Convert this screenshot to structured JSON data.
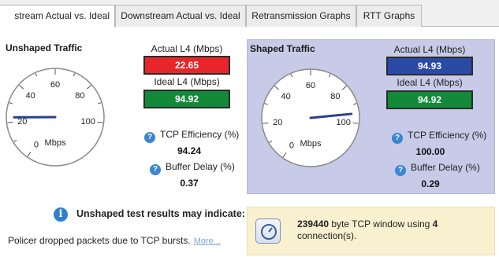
{
  "tabs": [
    {
      "label": "stream Actual vs. Ideal",
      "active": true
    },
    {
      "label": "Downstream Actual vs. Ideal",
      "active": false
    },
    {
      "label": "Retransmission Graphs",
      "active": false
    },
    {
      "label": "RTT Graphs",
      "active": false
    }
  ],
  "unshaped": {
    "title": "Unshaped Traffic",
    "gauge": {
      "unit": "Mbps",
      "ticks": [
        "0",
        "20",
        "40",
        "60",
        "80",
        "100"
      ],
      "value": 22.65,
      "max": 120
    },
    "actual_label": "Actual L4 (Mbps)",
    "actual_value": "22.65",
    "actual_color": "#e8262a",
    "ideal_label": "Ideal L4 (Mbps)",
    "ideal_value": "94.92",
    "ideal_color": "#13893a",
    "efficiency_label": "TCP Efficiency (%)",
    "efficiency_value": "94.24",
    "buffer_label": "Buffer Delay (%)",
    "buffer_value": "0.37"
  },
  "shaped": {
    "title": "Shaped Traffic",
    "gauge": {
      "unit": "Mbps",
      "ticks": [
        "0",
        "20",
        "40",
        "60",
        "80",
        "100"
      ],
      "value": 94.93,
      "max": 120
    },
    "actual_label": "Actual L4 (Mbps)",
    "actual_value": "94.93",
    "actual_color": "#2a4aa6",
    "ideal_label": "Ideal L4 (Mbps)",
    "ideal_value": "94.92",
    "ideal_color": "#13893a",
    "efficiency_label": "TCP Efficiency (%)",
    "efficiency_value": "100.00",
    "buffer_label": "Buffer Delay (%)",
    "buffer_value": "0.29"
  },
  "info": {
    "title": "Unshaped test results may indicate:",
    "text": "Policer dropped packets due to TCP bursts.",
    "more_label": "More..."
  },
  "window": {
    "bytes": "239440",
    "text_a": " byte TCP window using ",
    "connections": "4",
    "text_b": "connection(s)."
  },
  "colors": {
    "needle": "#2a3f8f",
    "panel_shaped": "#c7cbe8",
    "info_bg": "#f8f0cf"
  }
}
